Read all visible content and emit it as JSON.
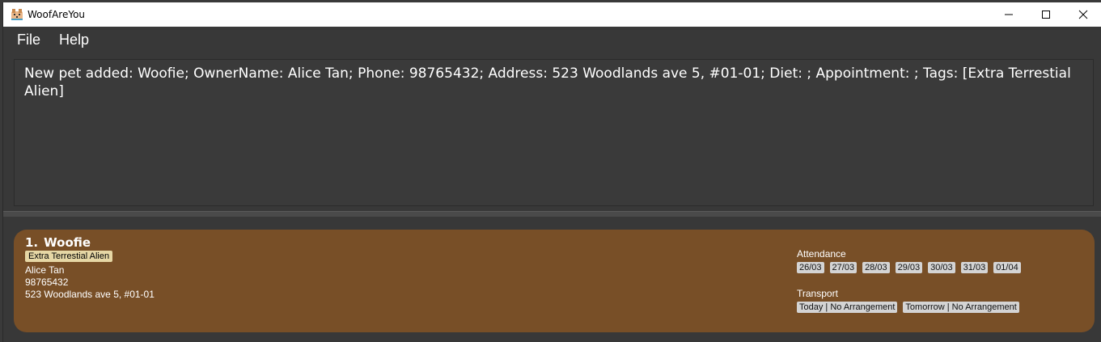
{
  "window": {
    "title": "WoofAreYou",
    "icon": "dog-app-icon"
  },
  "menu": {
    "file": "File",
    "help": "Help"
  },
  "result": {
    "text": "New pet added: Woofie; OwnerName: Alice Tan; Phone: 98765432; Address: 523 Woodlands ave 5, #01-01; Diet: ; Appointment: ; Tags: [Extra Terrestial Alien]"
  },
  "pets": [
    {
      "index": "1.",
      "name": "Woofie",
      "tags": [
        "Extra Terrestial Alien"
      ],
      "owner": "Alice Tan",
      "phone": "98765432",
      "address": "523 Woodlands ave 5, #01-01",
      "attendance_label": "Attendance",
      "attendance": [
        "26/03",
        "27/03",
        "28/03",
        "29/03",
        "30/03",
        "31/03",
        "01/04"
      ],
      "transport_label": "Transport",
      "transport": [
        "Today | No Arrangement",
        "Tomorrow | No Arrangement"
      ]
    }
  ],
  "colors": {
    "card_background": "#784f27",
    "tag_background": "#e6d7a5",
    "chip_background": "#d4d4d4",
    "app_background": "#383838"
  }
}
